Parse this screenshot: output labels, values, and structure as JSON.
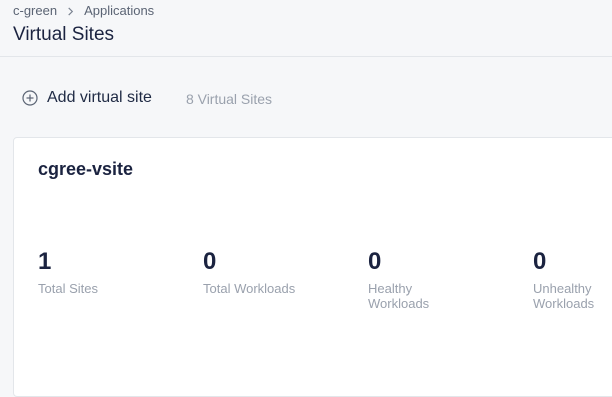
{
  "breadcrumb": {
    "items": [
      "c-green",
      "Applications"
    ]
  },
  "page": {
    "title": "Virtual Sites"
  },
  "toolbar": {
    "add_label": "Add virtual site",
    "count_label": "8 Virtual Sites"
  },
  "card": {
    "title": "cgree-vsite",
    "stats": [
      {
        "value": "1",
        "label": "Total Sites"
      },
      {
        "value": "0",
        "label": "Total Workloads"
      },
      {
        "value": "0",
        "label": "Healthy Workloads"
      },
      {
        "value": "0",
        "label": "Unhealthy Workloads"
      }
    ]
  },
  "icons": {
    "add": "plus-circle-icon",
    "separator": "chevron-right-icon"
  }
}
